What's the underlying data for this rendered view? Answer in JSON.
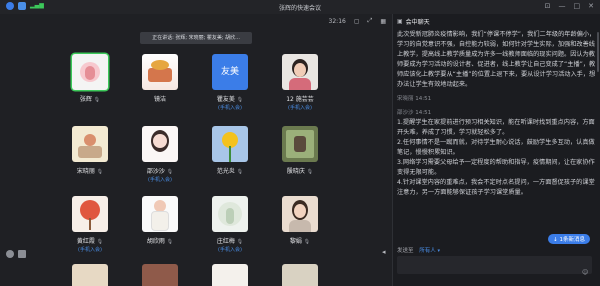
{
  "window": {
    "title": "张辉的快速会议",
    "time": "32:16"
  },
  "speaking": "正在讲话: 张辉; 宋晓丽; 瞿友美; 胡欣...",
  "participants": [
    {
      "name": "张辉",
      "sub": "",
      "mic": "🎙"
    },
    {
      "name": "镜洁",
      "sub": "",
      "mic": ""
    },
    {
      "name": "瞿友美",
      "sub": "(手机入会)",
      "mic": "🎙"
    },
    {
      "name": "12 施芸芸",
      "sub": "(手机入会)",
      "mic": ""
    },
    {
      "name": "宋晓丽",
      "sub": "",
      "mic": "🎙"
    },
    {
      "name": "邵沙沙",
      "sub": "(手机入会)",
      "mic": "🎙"
    },
    {
      "name": "范光炎",
      "sub": "",
      "mic": "🎙"
    },
    {
      "name": "殷晓庆",
      "sub": "",
      "mic": "🎙"
    },
    {
      "name": "黄红霞",
      "sub": "(手机入会)",
      "mic": "🎙"
    },
    {
      "name": "胡欣雨",
      "sub": "",
      "mic": "🎙"
    },
    {
      "name": "庄红梅",
      "sub": "(手机入会)",
      "mic": "🎙"
    },
    {
      "name": "黎娟",
      "sub": "",
      "mic": "🎙"
    }
  ],
  "avatar_label_3": "友美",
  "chat": {
    "header": "会中聊天",
    "messages": [
      {
        "meta": "",
        "text": "此次受新冠肺炎疫情影响，我们“停课不停学”，我们二年级的年龄偏小，学习的自觉意识不强，自控能力较弱，如何针对学生实际，加强和改善线上教学，提高线上教学质量成为许多一线教师面临的现实问题。因认为教师要成为学习活动的设计者、促进者，线上教学让自己变成了“主播”，教师应该化上教学要从“主播”的位置上退下来，要从设计学习活动入手，想办法让学生有效地动起来。"
      },
      {
        "meta": "宋晓丽 14:51",
        "text": ""
      },
      {
        "meta": "邵沙沙 14:51",
        "text": "1.提醒学生在家提前进行预习相关知识，能在听课时找到重点内容，方面开头难，养成了习惯，学习就轻松多了。\n2.任何事情不是一蹴而就，对待学生耐心说话，鼓励学生多互动，认真做笔记，慢慢积累知识。\n3.网络学习需要父母给予一定程度的帮助和指导，疫情期间，让在家协作变得无限可能。\n4.针对课堂内容的重难点，我会不定时点名提问，一方面督促孩子的课堂注意力，另一方面能够保证孩子学习课堂质量。"
      }
    ],
    "new_msg": "1条新消息",
    "send_to_label": "发送至",
    "send_to_value": "所有人",
    "input_placeholder": ""
  },
  "colors": {
    "accent": "#3b7de8",
    "active": "#3cc85a",
    "name": "#e6e7ea"
  }
}
